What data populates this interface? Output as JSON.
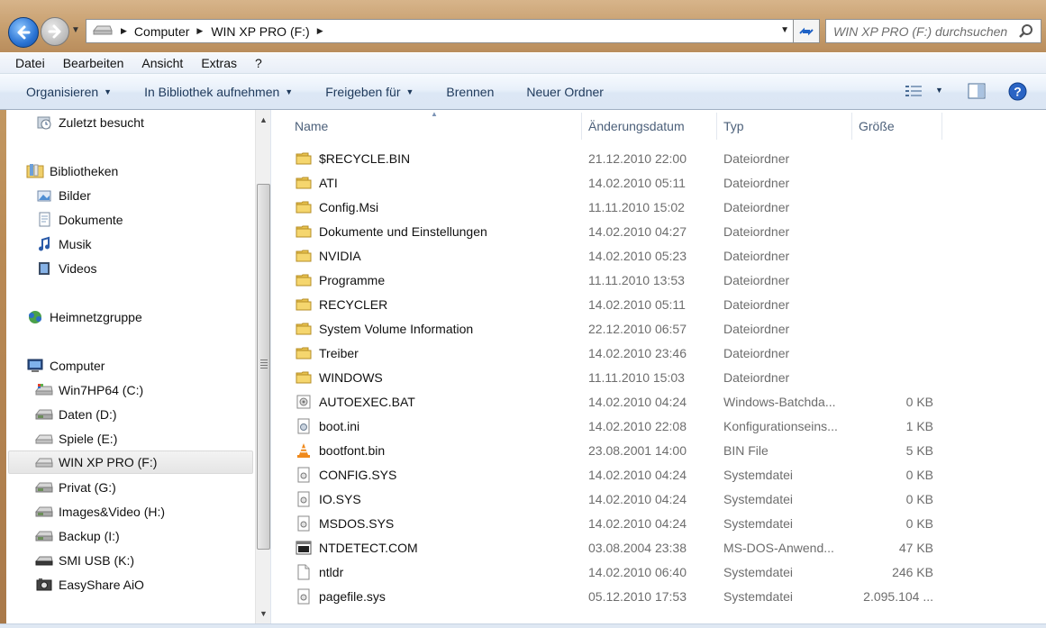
{
  "address": {
    "crumbs": [
      "Computer",
      "WIN XP PRO (F:)"
    ],
    "search_placeholder": "WIN XP PRO (F:) durchsuchen"
  },
  "menu": {
    "items": [
      "Datei",
      "Bearbeiten",
      "Ansicht",
      "Extras",
      "?"
    ]
  },
  "commands": {
    "organize": "Organisieren",
    "library": "In Bibliothek aufnehmen",
    "share": "Freigeben für",
    "burn": "Brennen",
    "new_folder": "Neuer Ordner"
  },
  "nav": {
    "recent": "Zuletzt besucht",
    "libraries": "Bibliotheken",
    "library_items": [
      "Bilder",
      "Dokumente",
      "Musik",
      "Videos"
    ],
    "homegroup": "Heimnetzgruppe",
    "computer": "Computer",
    "drives": [
      {
        "label": "Win7HP64 (C:)",
        "icon": "system-drive-icon"
      },
      {
        "label": "Daten (D:)",
        "icon": "hard-drive-icon"
      },
      {
        "label": "Spiele (E:)",
        "icon": "removable-drive-icon"
      },
      {
        "label": "WIN XP PRO (F:)",
        "icon": "removable-drive-icon",
        "selected": true
      },
      {
        "label": "Privat (G:)",
        "icon": "hard-drive-icon"
      },
      {
        "label": "Images&Video (H:)",
        "icon": "hard-drive-icon"
      },
      {
        "label": "Backup (I:)",
        "icon": "hard-drive-icon"
      },
      {
        "label": "SMI USB (K:)",
        "icon": "usb-drive-icon"
      },
      {
        "label": "EasyShare AiO",
        "icon": "camera-icon"
      }
    ]
  },
  "columns": {
    "name": "Name",
    "date": "Änderungsdatum",
    "type": "Typ",
    "size": "Größe"
  },
  "files": [
    {
      "name": "$RECYCLE.BIN",
      "date": "21.12.2010 22:00",
      "type": "Dateiordner",
      "size": "",
      "icon": "folder-icon"
    },
    {
      "name": "ATI",
      "date": "14.02.2010 05:11",
      "type": "Dateiordner",
      "size": "",
      "icon": "folder-icon"
    },
    {
      "name": "Config.Msi",
      "date": "11.11.2010 15:02",
      "type": "Dateiordner",
      "size": "",
      "icon": "folder-icon"
    },
    {
      "name": "Dokumente und Einstellungen",
      "date": "14.02.2010 04:27",
      "type": "Dateiordner",
      "size": "",
      "icon": "folder-icon"
    },
    {
      "name": "NVIDIA",
      "date": "14.02.2010 05:23",
      "type": "Dateiordner",
      "size": "",
      "icon": "folder-icon"
    },
    {
      "name": "Programme",
      "date": "11.11.2010 13:53",
      "type": "Dateiordner",
      "size": "",
      "icon": "folder-icon"
    },
    {
      "name": "RECYCLER",
      "date": "14.02.2010 05:11",
      "type": "Dateiordner",
      "size": "",
      "icon": "folder-icon"
    },
    {
      "name": "System Volume Information",
      "date": "22.12.2010 06:57",
      "type": "Dateiordner",
      "size": "",
      "icon": "folder-icon"
    },
    {
      "name": "Treiber",
      "date": "14.02.2010 23:46",
      "type": "Dateiordner",
      "size": "",
      "icon": "folder-icon"
    },
    {
      "name": "WINDOWS",
      "date": "11.11.2010 15:03",
      "type": "Dateiordner",
      "size": "",
      "icon": "folder-icon"
    },
    {
      "name": "AUTOEXEC.BAT",
      "date": "14.02.2010 04:24",
      "type": "Windows-Batchda...",
      "size": "0 KB",
      "icon": "batch-file-icon"
    },
    {
      "name": "boot.ini",
      "date": "14.02.2010 22:08",
      "type": "Konfigurationseins...",
      "size": "1 KB",
      "icon": "settings-file-icon"
    },
    {
      "name": "bootfont.bin",
      "date": "23.08.2001 14:00",
      "type": "BIN File",
      "size": "5 KB",
      "icon": "vlc-cone-icon"
    },
    {
      "name": "CONFIG.SYS",
      "date": "14.02.2010 04:24",
      "type": "Systemdatei",
      "size": "0 KB",
      "icon": "system-file-icon"
    },
    {
      "name": "IO.SYS",
      "date": "14.02.2010 04:24",
      "type": "Systemdatei",
      "size": "0 KB",
      "icon": "system-file-icon"
    },
    {
      "name": "MSDOS.SYS",
      "date": "14.02.2010 04:24",
      "type": "Systemdatei",
      "size": "0 KB",
      "icon": "system-file-icon"
    },
    {
      "name": "NTDETECT.COM",
      "date": "03.08.2004 23:38",
      "type": "MS-DOS-Anwend...",
      "size": "47 KB",
      "icon": "dos-app-icon"
    },
    {
      "name": "ntldr",
      "date": "14.02.2010 06:40",
      "type": "Systemdatei",
      "size": "246 KB",
      "icon": "generic-file-icon"
    },
    {
      "name": "pagefile.sys",
      "date": "05.12.2010 17:53",
      "type": "Systemdatei",
      "size": "2.095.104 ...",
      "icon": "system-file-icon"
    }
  ],
  "colors": {
    "command_text": "#1e395b",
    "folder_yellow": "#e9c34f",
    "detail_gray": "#6d6d6d"
  }
}
